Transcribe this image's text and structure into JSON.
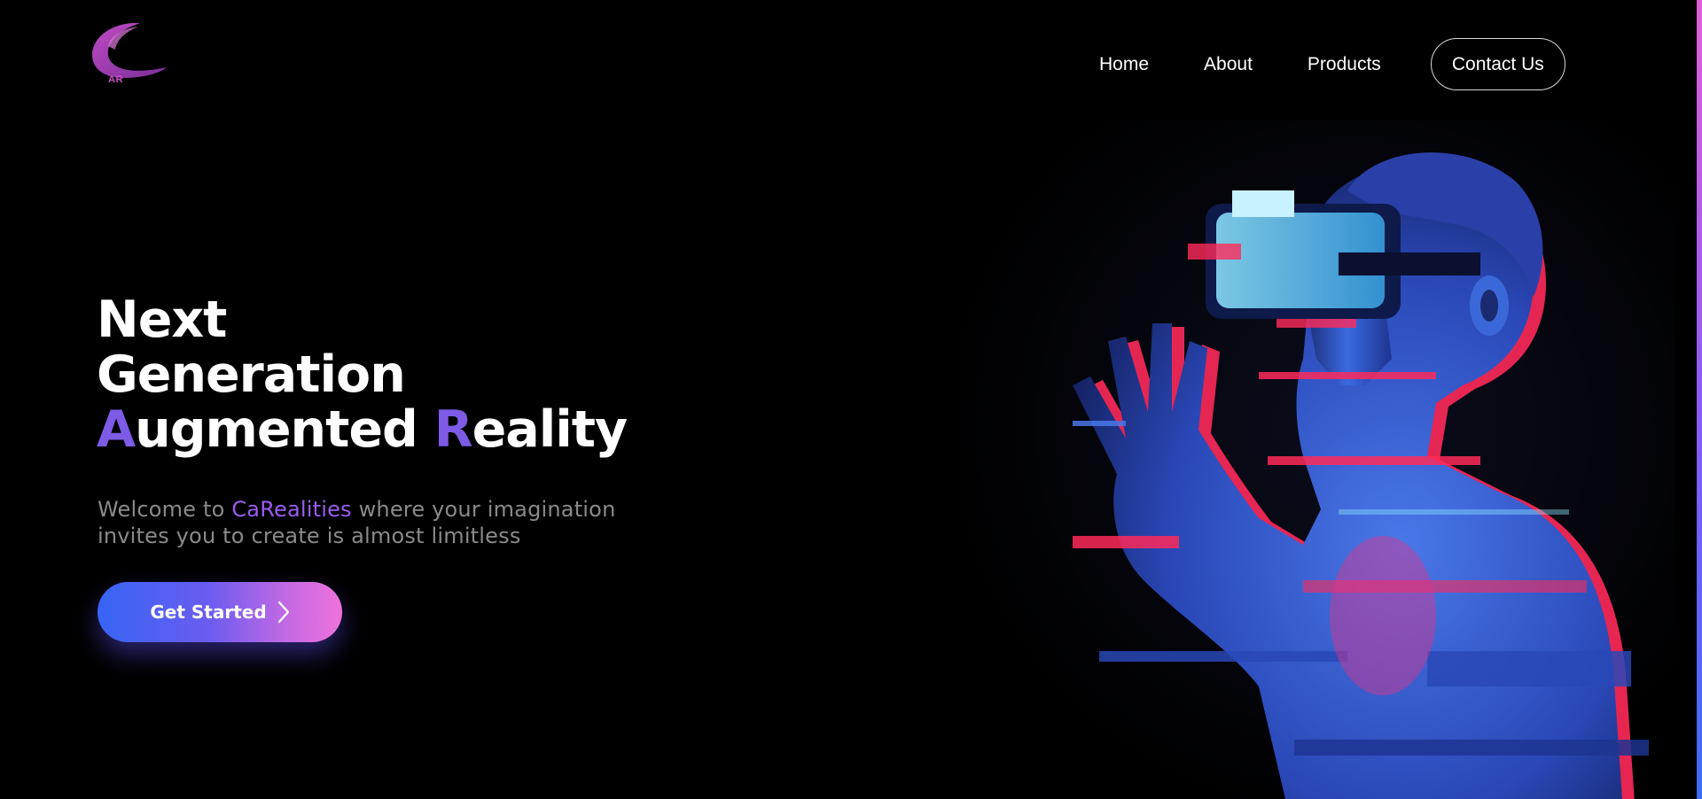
{
  "header": {
    "logo_text": "AR",
    "nav": [
      {
        "label": "Home"
      },
      {
        "label": "About"
      },
      {
        "label": "Products"
      }
    ],
    "contact_label": "Contact Us"
  },
  "hero": {
    "title_line1": "Next",
    "title_line2": "Generation",
    "title_line3_a_first": "A",
    "title_line3_a_rest": "ugmented ",
    "title_line3_r_first": "R",
    "title_line3_r_rest": "eality",
    "subtitle_pre": "Welcome to ",
    "subtitle_brand": "CaRealities",
    "subtitle_post": " where your imagination invites you to create is almost limitless",
    "cta_label": "Get Started"
  },
  "colors": {
    "background": "#000000",
    "accent": "#7d5be6",
    "brand_text": "#9a5cf0",
    "cta_start": "#3665f5",
    "cta_end": "#ee73dc"
  },
  "icons": {
    "cta_icon": "chevron-right-icon",
    "logo": "crescent-logo-icon"
  }
}
